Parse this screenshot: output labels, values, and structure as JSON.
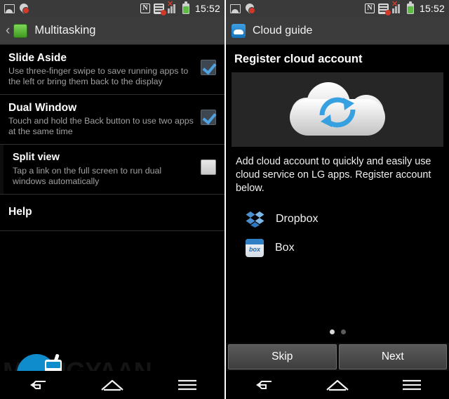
{
  "left_phone": {
    "status_bar": {
      "icons": [
        "image-icon",
        "location-alert-icon",
        "nfc-icon",
        "sync-error-icon",
        "signal-error-icon",
        "battery-icon"
      ],
      "clock": "15:52"
    },
    "action_bar": {
      "back_glyph": "‹",
      "app_icon": "multitasking-icon",
      "title": "Multitasking"
    },
    "settings": [
      {
        "title": "Slide Aside",
        "subtitle": "Use three-finger swipe to save running apps to the left or bring them back to the display",
        "checked": true,
        "indent": false
      },
      {
        "title": "Dual Window",
        "subtitle": "Touch and hold the Back button to use two apps at the same time",
        "checked": true,
        "indent": false
      },
      {
        "title": "Split view",
        "subtitle": "Tap a link on the full screen to run dual windows automatically",
        "checked": false,
        "indent": true
      }
    ],
    "help_label": "Help",
    "nav": [
      "back-icon",
      "home-icon",
      "menu-icon"
    ],
    "watermark": "MOBIGYAAN"
  },
  "right_phone": {
    "status_bar": {
      "icons": [
        "image-icon",
        "location-alert-icon",
        "nfc-icon",
        "sync-error-icon",
        "signal-error-icon",
        "battery-icon"
      ],
      "clock": "15:52"
    },
    "action_bar": {
      "app_icon": "cloud-icon",
      "title": "Cloud guide"
    },
    "page_title": "Register cloud account",
    "hero_icon": "cloud-sync-icon",
    "description": "Add cloud account to quickly and easily use cloud service on LG apps. Register account below.",
    "services": [
      {
        "name": "Dropbox",
        "icon": "dropbox-icon"
      },
      {
        "name": "Box",
        "icon": "box-icon",
        "glyph": "box"
      }
    ],
    "pager": {
      "total": 2,
      "active_index": 0
    },
    "buttons": {
      "skip": "Skip",
      "next": "Next"
    },
    "nav": [
      "back-icon",
      "home-icon",
      "menu-icon"
    ]
  },
  "colors": {
    "accent_blue": "#4fa3e3",
    "brand_blue": "#0f8ccc",
    "bar_gray": "#3c3c3c",
    "battery_green": "#5dbb46"
  }
}
